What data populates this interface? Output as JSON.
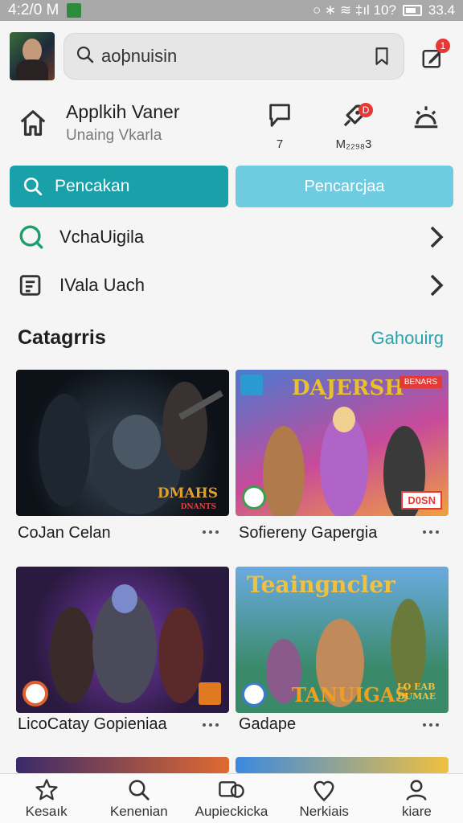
{
  "status_bar": {
    "time": "4:2/0 M",
    "right_text": "○ ∗ ≋ ‡ıl 10?",
    "battery": "33.4"
  },
  "search": {
    "value": "aoþnuisin"
  },
  "header_badges": {
    "edit": "1"
  },
  "app_header": {
    "title": "Applkih Vaner",
    "subtitle": "Unaing Vkarla",
    "actions": [
      {
        "icon": "chat-bubble-icon",
        "label": "7"
      },
      {
        "icon": "rocket-icon",
        "label": "M₂₂₉₈3",
        "badge": "D"
      },
      {
        "icon": "sunrise-icon",
        "label": ""
      }
    ]
  },
  "buttons": {
    "primary": "Pencakan",
    "secondary": "Pencarcjaa"
  },
  "list_rows": [
    {
      "icon": "search-icon",
      "label": "VchaUigila"
    },
    {
      "icon": "document-icon",
      "label": "IVala Uach"
    }
  ],
  "section": {
    "title": "Catagrris",
    "link": "Gahouirg"
  },
  "cards": [
    {
      "caption": "CoJan Celan",
      "art_text": "DMAHS",
      "art_subtext": "DNANTS"
    },
    {
      "caption": "Sofiereny Gapergia",
      "art_text": "DAJERSH",
      "art_subtext": "D0SN",
      "ribbon": "BENARS"
    },
    {
      "caption": "LicoCatay Gopieniaa",
      "art_text": "",
      "art_subtext": ""
    },
    {
      "caption": "Gadape",
      "art_text": "Teaingncler",
      "art_subtext": "TANUIGAS",
      "corner_text": "LO EAB DUMAE"
    }
  ],
  "bottom_nav": [
    {
      "icon": "star-icon",
      "label": "Kesaık"
    },
    {
      "icon": "search-icon",
      "label": "Kenenian"
    },
    {
      "icon": "gallery-icon",
      "label": "Aupieckicka"
    },
    {
      "icon": "heart-pin-icon",
      "label": "Nerkiais"
    },
    {
      "icon": "person-icon",
      "label": "kiare"
    }
  ],
  "colors": {
    "status_bar": "#a9a9a9",
    "primary_button": "#1aa0a8",
    "secondary_button": "#6fcbe0",
    "accent_link": "#2aa2ad",
    "badge": "#e53935"
  }
}
